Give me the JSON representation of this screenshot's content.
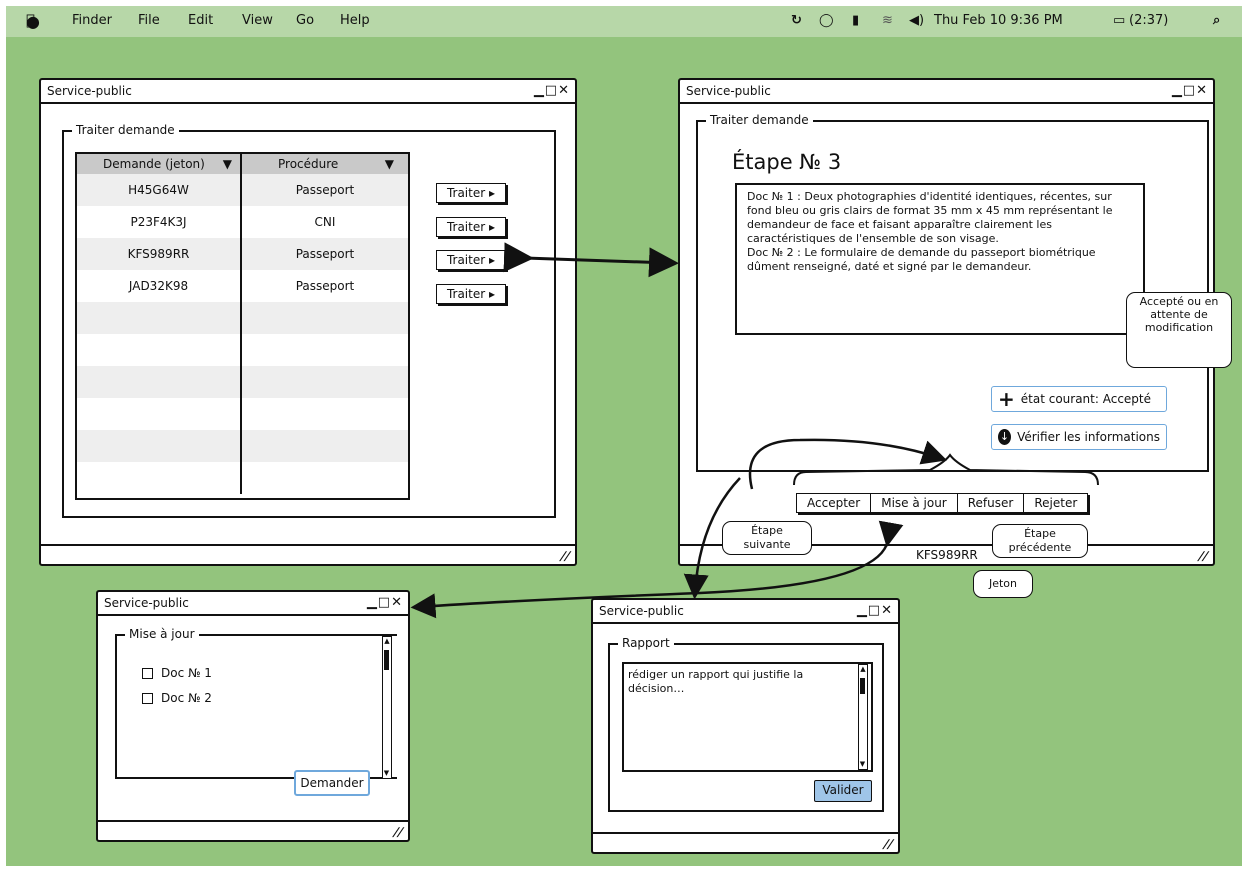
{
  "menubar": {
    "items": [
      "Finder",
      "File",
      "Edit",
      "View",
      "Go",
      "Help"
    ],
    "clock": "Thu Feb 10  9:36 PM",
    "battery": "(2:37)"
  },
  "win_list": {
    "title": "Service-public",
    "group_label": "Traiter demande",
    "columns": [
      "Demande (jeton)",
      "Procédure"
    ],
    "rows": [
      {
        "jeton": "H45G64W",
        "procedure": "Passeport"
      },
      {
        "jeton": "P23F4K3J",
        "procedure": "CNI"
      },
      {
        "jeton": "KFS989RR",
        "procedure": "Passeport"
      },
      {
        "jeton": "JAD32K98",
        "procedure": "Passeport"
      }
    ],
    "treat_label": "Traiter"
  },
  "win_step": {
    "title": "Service-public",
    "group_label": "Traiter demande",
    "heading": "Étape № 3",
    "doc_text": "Doc № 1 : Deux photographies d'identité identiques, récentes, sur fond bleu ou gris clairs de format 35 mm x 45 mm représentant le demandeur de face et faisant apparaître clairement les caractéristiques de l'ensemble de son visage.\nDoc № 2 : Le formulaire de demande du passeport biométrique dûment renseigné, daté et signé par le demandeur.",
    "state_button": "état courant: Accepté",
    "verify_button": "Vérifier les informations",
    "actions": [
      "Accepter",
      "Mise à jour",
      "Refuser",
      "Rejeter"
    ],
    "status_token": "KFS989RR",
    "callout_state": "Accepté ou en attente de modification",
    "callout_next": "Étape suivante",
    "callout_prev": "Étape précédente",
    "callout_token": "Jeton"
  },
  "win_update": {
    "title": "Service-public",
    "group_label": "Mise à jour",
    "docs": [
      "Doc № 1",
      "Doc № 2"
    ],
    "request_button": "Demander"
  },
  "win_report": {
    "title": "Service-public",
    "group_label": "Rapport",
    "textarea_value": "rédiger un rapport qui justifie la décision…",
    "submit_button": "Valider"
  }
}
